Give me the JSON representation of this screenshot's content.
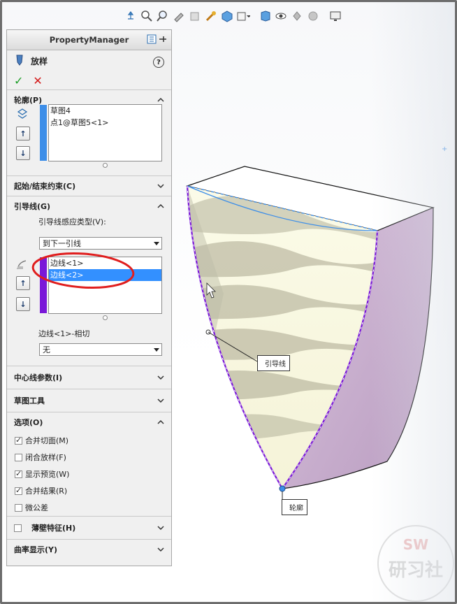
{
  "toolbar": {
    "icons": [
      "view-orientation-icon",
      "zoom-to-fit-icon",
      "zoom-area-icon",
      "previous-view-icon",
      "section-view-icon",
      "dynamic-annotation-icon",
      "view-orientation-cube-icon",
      "display-style-icon",
      "hide-show-icon",
      "edit-appearance-icon",
      "apply-scene-icon",
      "view-settings-icon",
      "monitor-icon"
    ]
  },
  "pm": {
    "title": "PropertyManager",
    "feature": "放样",
    "profiles": {
      "header": "轮廓(P)",
      "items": [
        "草图4",
        "点1@草图5<1>"
      ]
    },
    "start_end": {
      "header": "起始/结束约束(C)"
    },
    "guides": {
      "header": "引导线(G)",
      "influence_label": "引导线感应类型(V):",
      "influence_value": "到下一引线",
      "items": [
        "边线<1>",
        "边线<2>"
      ],
      "tangency_label": "边线<1>-相切",
      "tangency_value": "无"
    },
    "centerline": {
      "header": "中心线参数(I)"
    },
    "sketch_tools": {
      "header": "草图工具"
    },
    "options": {
      "header": "选项(O)",
      "items": [
        {
          "label": "合并切面(M)",
          "checked": true
        },
        {
          "label": "闭合放样(F)",
          "checked": false
        },
        {
          "label": "显示预览(W)",
          "checked": true
        },
        {
          "label": "合并结果(R)",
          "checked": true
        },
        {
          "label": "微公差",
          "checked": false
        }
      ]
    },
    "thin": {
      "header": "薄壁特征(H)"
    },
    "curvature": {
      "header": "曲率显示(Y)"
    }
  },
  "viewport": {
    "guide_callout": "引导线",
    "profile_callout": "轮廓"
  },
  "watermark": {
    "top": "SW",
    "bottom": "研习社"
  },
  "colors": {
    "accent_blue": "#3d8ee8",
    "purple": "#7a18d8",
    "highlight": "#3390ff",
    "loft_side": "#d0b4d4"
  }
}
